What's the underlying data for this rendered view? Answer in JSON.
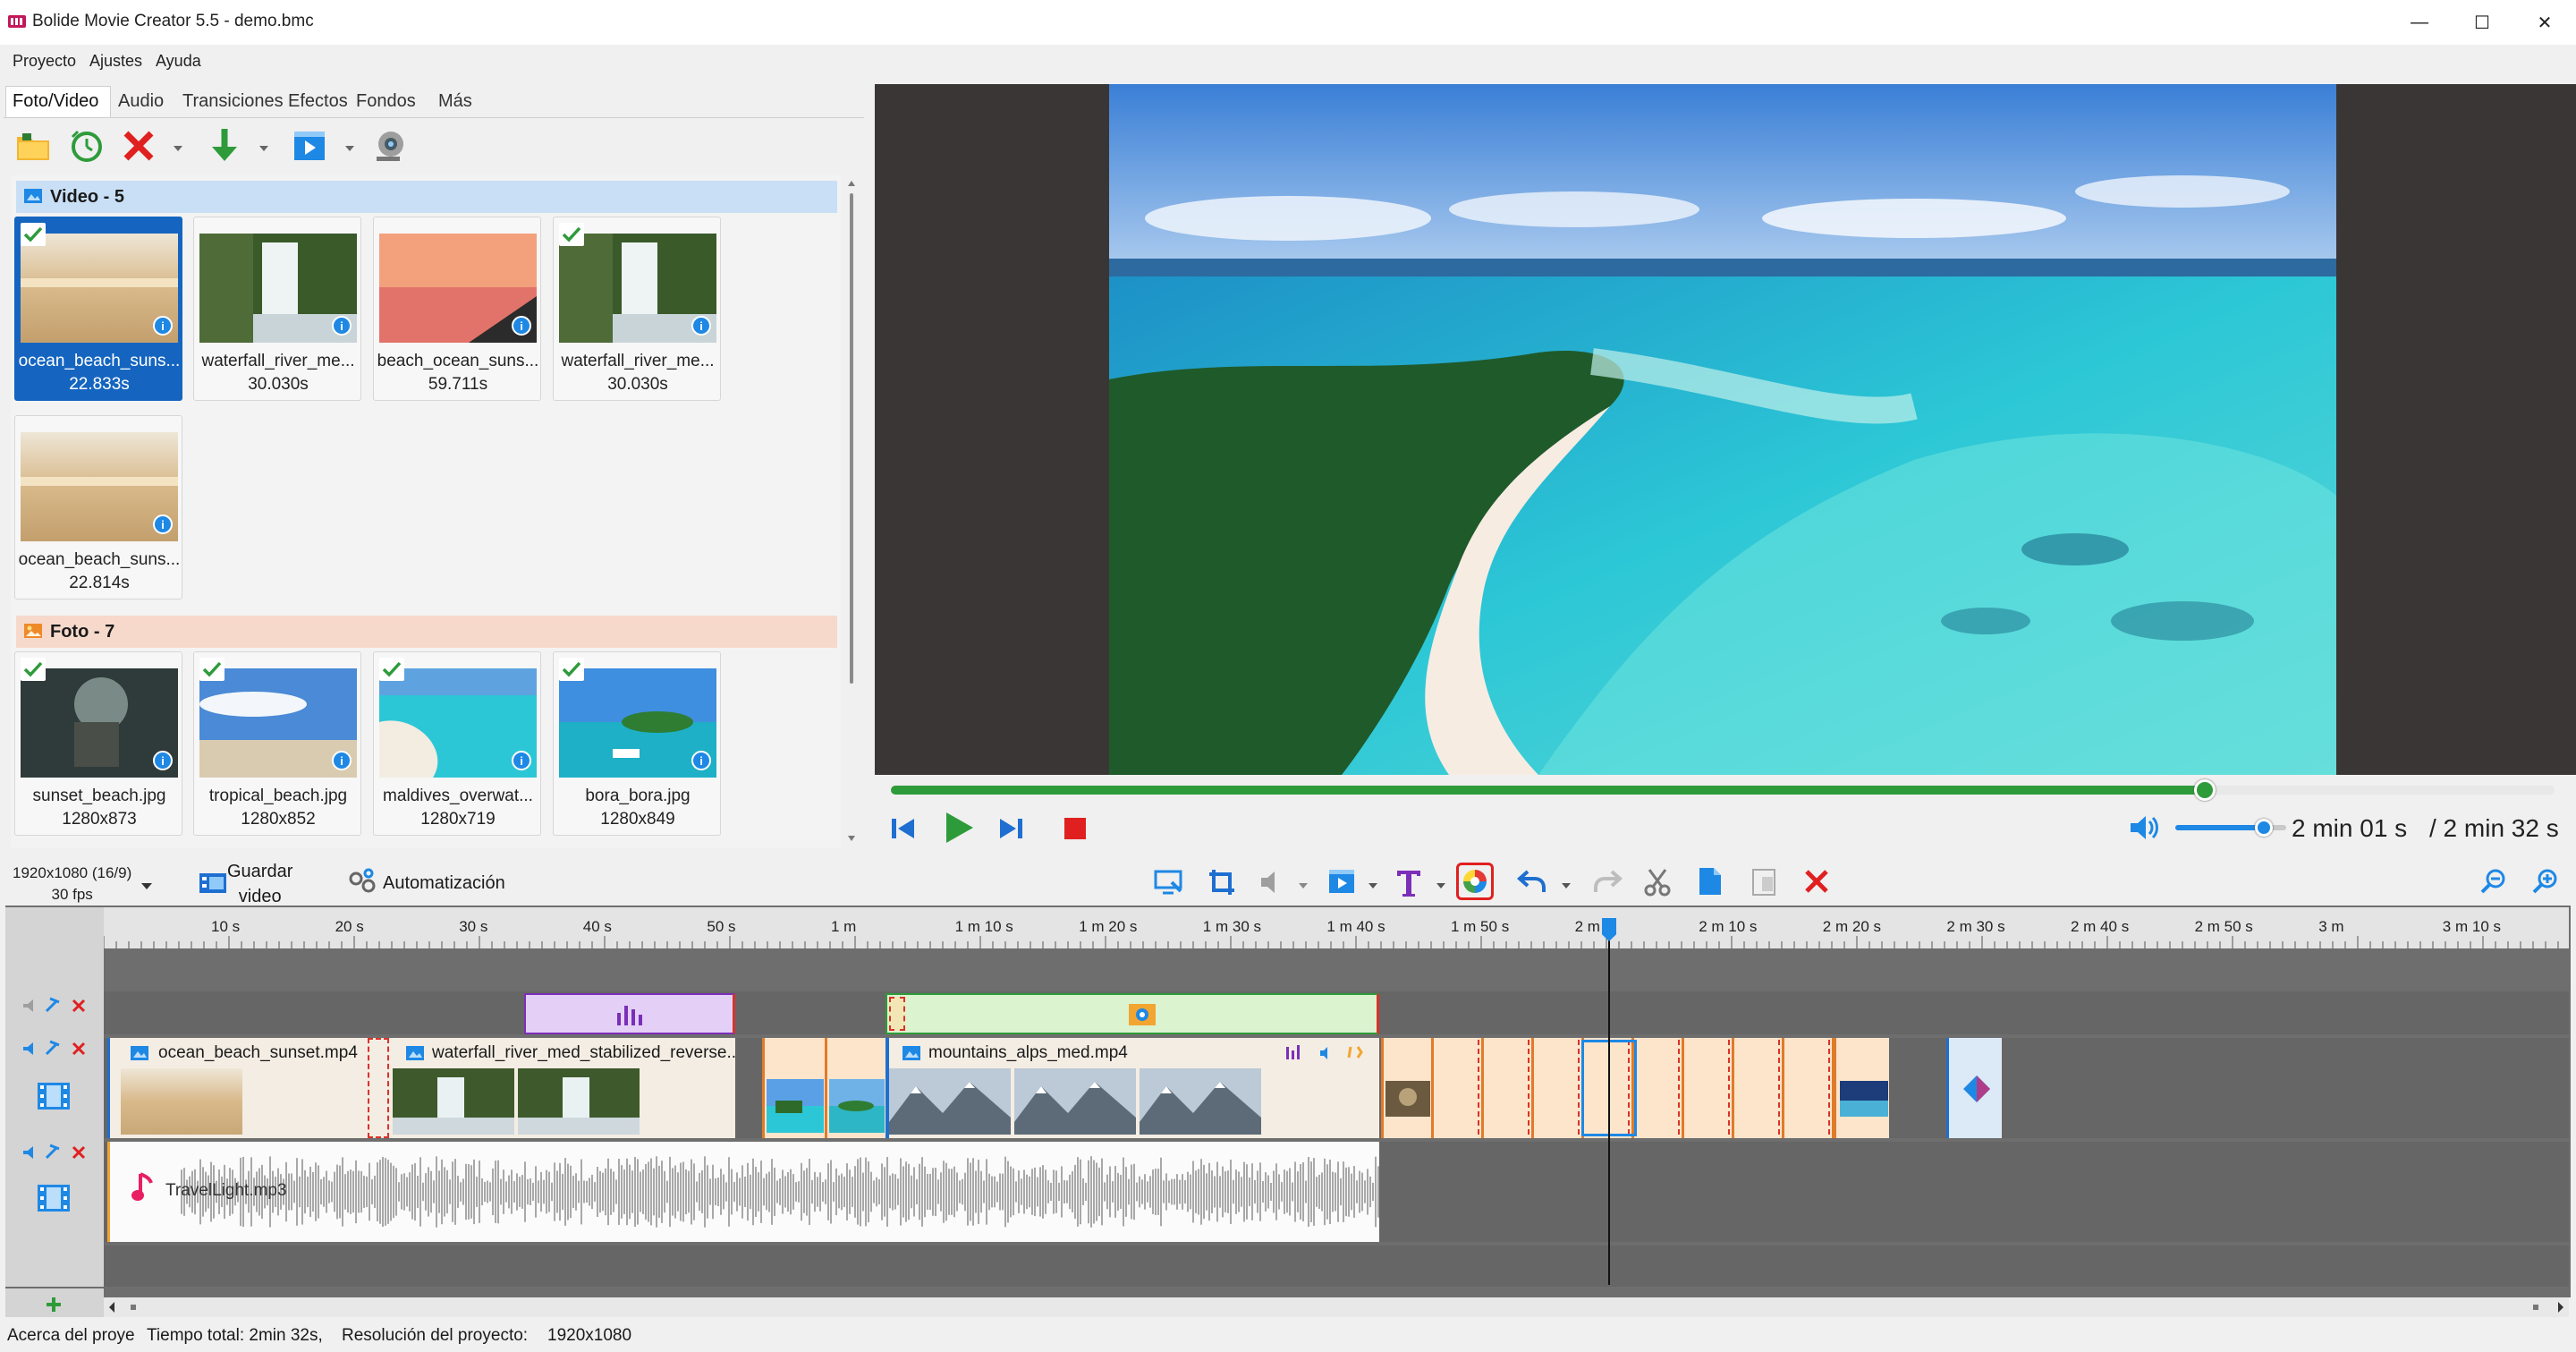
{
  "window": {
    "title": "Bolide Movie Creator 5.5 - demo.bmc",
    "minimize": "—",
    "maximize": "☐",
    "close": "✕"
  },
  "menu": [
    "Proyecto",
    "Ajustes",
    "Ayuda"
  ],
  "tabs": [
    "Foto/Video",
    "Audio",
    "Transiciones",
    "Efectos",
    "Fondos",
    "Más"
  ],
  "library": {
    "video_group": "Video - 5",
    "photo_group": "Foto - 7",
    "videos": [
      {
        "name": "ocean_beach_suns...",
        "info": "22.833s",
        "checked": true,
        "selected": true,
        "thumb": "sand"
      },
      {
        "name": "waterfall_river_me...",
        "info": "30.030s",
        "checked": false,
        "selected": false,
        "thumb": "waterfall"
      },
      {
        "name": "beach_ocean_suns...",
        "info": "59.711s",
        "checked": false,
        "selected": false,
        "thumb": "sunset"
      },
      {
        "name": "waterfall_river_me...",
        "info": "30.030s",
        "checked": true,
        "selected": false,
        "thumb": "waterfall"
      },
      {
        "name": "ocean_beach_suns...",
        "info": "22.814s",
        "checked": false,
        "selected": false,
        "thumb": "sand"
      }
    ],
    "photos": [
      {
        "name": "sunset_beach.jpg",
        "info": "1280x873",
        "checked": true,
        "thumb": "forest"
      },
      {
        "name": "tropical_beach.jpg",
        "info": "1280x852",
        "checked": true,
        "thumb": "sky"
      },
      {
        "name": "maldives_overwat...",
        "info": "1280x719",
        "checked": true,
        "thumb": "maldives"
      },
      {
        "name": "bora_bora.jpg",
        "info": "1280x849",
        "checked": true,
        "thumb": "island"
      }
    ]
  },
  "player": {
    "progress": 0.79,
    "volume": 0.8,
    "current_time": "2 min 01 s",
    "total_time": "/ 2 min 32 s"
  },
  "bottom_toolbar": {
    "resolution": "1920x1080 (16/9)",
    "fps": "30 fps",
    "save_line1": "Guardar",
    "save_line2": "video",
    "automation": "Automatización"
  },
  "timeline": {
    "ticks": [
      "10 s",
      "20 s",
      "30 s",
      "40 s",
      "50 s",
      "1 m",
      "1 m 10 s",
      "1 m 20 s",
      "1 m 30 s",
      "1 m 40 s",
      "1 m 50 s",
      "2 m",
      "2 m 10 s",
      "2 m 20 s",
      "2 m 30 s",
      "2 m 40 s",
      "2 m 50 s",
      "3 m",
      "3 m 10 s"
    ],
    "video_clips": [
      {
        "label": "ocean_beach_sunset.mp4"
      },
      {
        "label": "waterfall_river_med_stabilized_reverse..."
      },
      {
        "label": "mountains_alps_med.mp4"
      }
    ],
    "audio_clip": "TravelLight.mp3"
  },
  "status": {
    "about": "Acerca del proye",
    "total": "Tiempo total: 2min 32s,",
    "resolution": "Resolución del proyecto:",
    "resolution_value": "1920x1080"
  },
  "colors": {
    "accent": "#1565c0",
    "progress": "#2e9b3a",
    "video_group_bg": "#c9dff5",
    "photo_group_bg": "#f7d9cc"
  }
}
